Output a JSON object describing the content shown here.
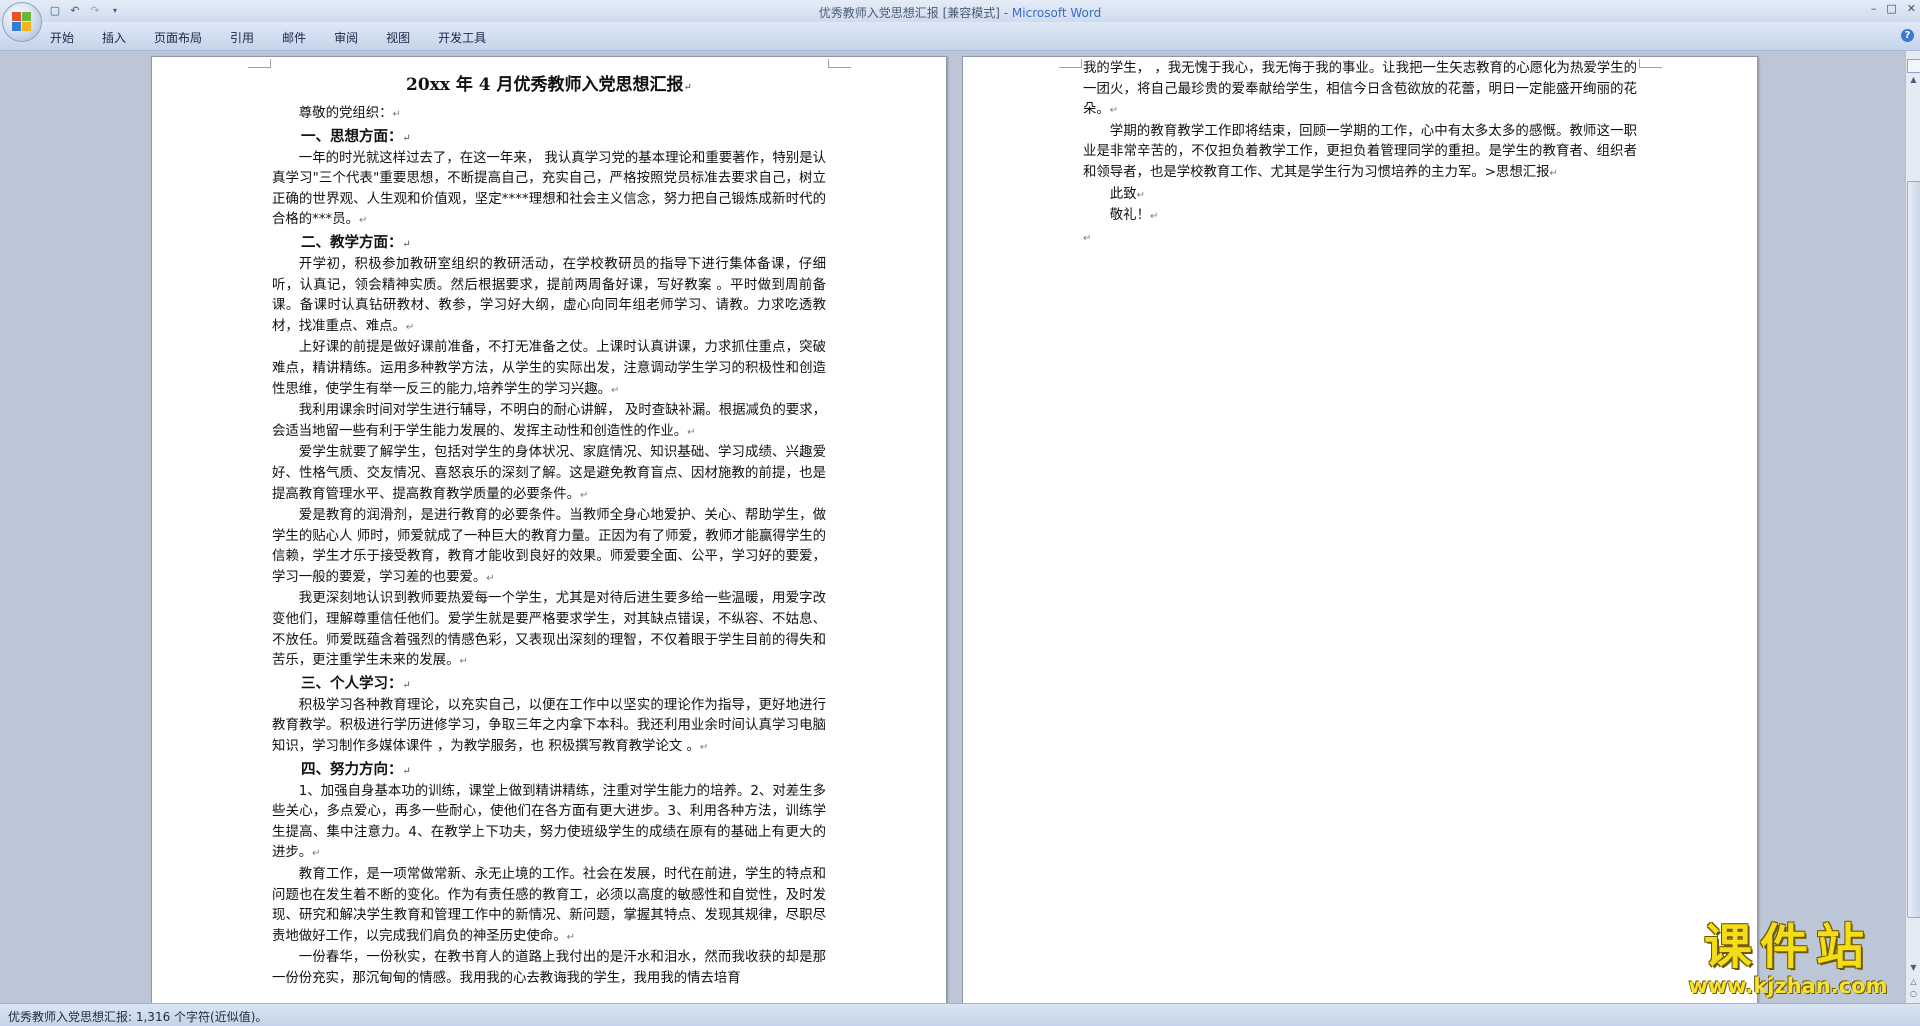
{
  "window": {
    "title": "优秀教师入党思想汇报 [兼容模式] - ",
    "app_name": "Microsoft Word",
    "controls": [
      "–",
      "□",
      "✕"
    ]
  },
  "quick_access": {
    "save_icon": "save-icon",
    "undo_icon": "undo-icon",
    "redo_icon": "redo-icon",
    "customize_icon": "qat-dropdown-icon"
  },
  "ribbon": {
    "tabs": [
      "开始",
      "插入",
      "页面布局",
      "引用",
      "邮件",
      "审阅",
      "视图",
      "开发工具"
    ],
    "help": "?"
  },
  "document": {
    "pilcrow": "↵",
    "title": "20xx 年 4 月优秀教师入党思想汇报",
    "salutation": "尊敬的党组织：",
    "s1_heading": "一、思想方面：",
    "s1_p1": "一年的时光就这样过去了，在这一年来，    我认真学习党的基本理论和重要著作，特别是认真学习\"三个代表\"重要思想，不断提高自己，充实自己，严格按照党员标准去要求自己，树立正确的世界观、人生观和价值观，坚定****理想和社会主义信念，努力把自己锻炼成新时代的合格的***员。",
    "s2_heading": "二、教学方面：",
    "s2_p1": "开学初，积极参加教研室组织的教研活动，在学校教研员的指导下进行集体备课，仔细听，认真记，领会精神实质。然后根据要求，提前两周备好课，写好教案   。平时做到周前备课。备课时认真钻研教材、教参，学习好大纲，虚心向同年组老师学习、请教。力求吃透教材，找准重点、难点。",
    "s2_p2": "上好课的前提是做好课前准备，不打无准备之仗。上课时认真讲课，力求抓住重点，突破难点，精讲精练。运用多种教学方法，从学生的实际出发，注意调动学生学习的积极性和创造性思维，使学生有举一反三的能力,培养学生的学习兴趣。",
    "s2_p3": "我利用课余时间对学生进行辅导，不明白的耐心讲解，  及时查缺补漏。根据减负的要求，会适当地留一些有利于学生能力发展的、发挥主动性和创造性的作业。",
    "s2_p4": "爱学生就要了解学生，包括对学生的身体状况、家庭情况、知识基础、学习成绩、兴趣爱好、性格气质、交友情况、喜怒哀乐的深刻了解。这是避免教育盲点、因材施教的前提，也是提高教育管理水平、提高教育教学质量的必要条件。",
    "s2_p5": "爱是教育的润滑剂，是进行教育的必要条件。当教师全身心地爱护、关心、帮助学生，做学生的贴心人    师时，师爱就成了一种巨大的教育力量。正因为有了师爱，教师才能赢得学生的信赖，学生才乐于接受教育，教育才能收到良好的效果。师爱要全面、公平，学习好的要爱，学习一般的要爱，学习差的也要爱。",
    "s2_p6": "我更深刻地认识到教师要热爱每一个学生，尤其是对待后进生要多给一些温暖，用爱字改变他们，理解尊重信任他们。爱学生就是要严格要求学生，对其缺点错误，不纵容、不姑息、不放任。师爱既蕴含着强烈的情感色彩，又表现出深刻的理智，不仅着眼于学生目前的得失和苦乐，更注重学生未来的发展。",
    "s3_heading": "三、个人学习：",
    "s3_p1": "积极学习各种教育理论，以充实自己，以便在工作中以坚实的理论作为指导，更好地进行教育教学。积极进行学历进修学习，争取三年之内拿下本科。我还利用业余时间认真学习电脑知识，学习制作多媒体课件   ，为教学服务，也  积极撰写教育教学论文 。",
    "s4_heading": "四、努力方向：",
    "s4_p1": "1、加强自身基本功的训练，课堂上做到精讲精练，注重对学生能力的培养。2、对差生多些关心，多点爱心，再多一些耐心，使他们在各方面有更大进步。3、利用各种方法，训练学生提高、集中注意力。4、在教学上下功夫，努力使班级学生的成绩在原有的基础上有更大的进步。",
    "s4_p2": "教育工作，是一项常做常新、永无止境的工作。社会在发展，时代在前进，学生的特点和问题也在发生着不断的变化。作为有责任感的教育工，必须以高度的敏感性和自觉性，及时发现、研究和解决学生教育和管理工作中的新情况、新问题，掌握其特点、发现其规律，尽职尽责地做好工作，以完成我们肩负的神圣历史使命。",
    "s4_p3": "一份春华，一份秋实，在教书育人的道路上我付出的是汗水和泪水，然而我收获的却是那一份份充实，那沉甸甸的情感。我用我的心去教诲我的学生，我用我的情去培育",
    "p2_p1": "我的学生，    ，我无愧于我心，我无悔于我的事业。让我把一生矢志教育的心愿化为热爱学生的一团火，将自己最珍贵的爱奉献给学生，相信今日含苞欲放的花蕾，明日一定能盛开绚丽的花朵。",
    "p2_p2": "学期的教育教学工作即将结束，回顾一学期的工作，心中有太多太多的感慨。教师这一职业是非常辛苦的，不仅担负着教学工作，更担负着管理同学的重担。是学生的教育者、组织者和领导者，也是学校教育工作、尤其是学生行为习惯培养的主力军。>思想汇报",
    "p2_close1": "此致",
    "p2_close2": "敬礼！"
  },
  "status": {
    "text": "优秀教师入党思想汇报: 1,316 个字符(近似值)。"
  },
  "watermark": {
    "main": "课件站",
    "url": "www.kjzhan.com"
  },
  "colors": {
    "app_name": "#3e6cc1",
    "watermark": "#f3dc18"
  }
}
